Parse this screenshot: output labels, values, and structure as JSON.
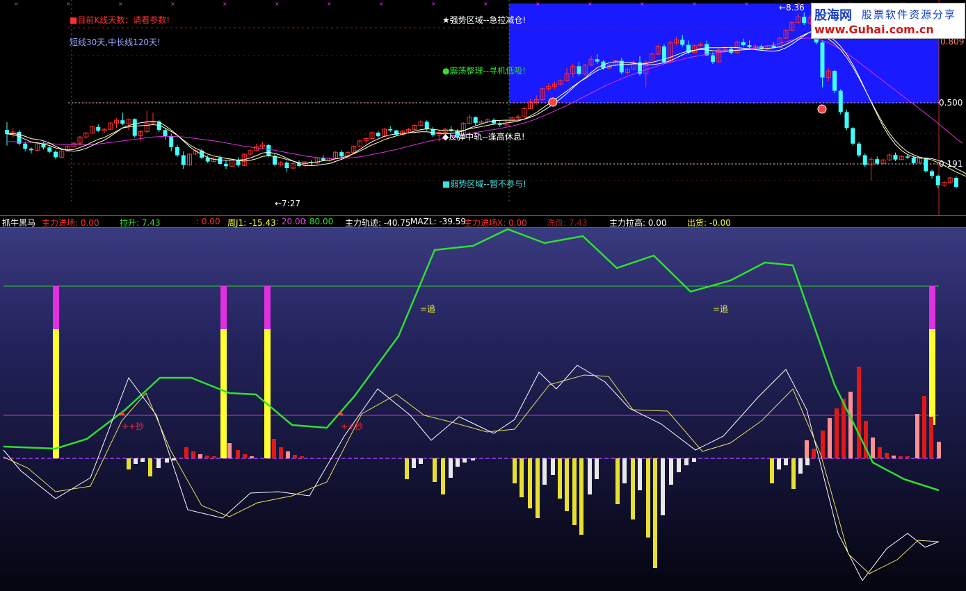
{
  "top_panel": {
    "annotations": [
      {
        "id": "kline",
        "text": "■目前K线天数：请看参数!",
        "color": "#ff3030"
      },
      {
        "id": "mapar",
        "text": "短线30天,中长线120天!",
        "color": "#9aa8ff"
      },
      {
        "id": "strong",
        "text": "★强势区域--急拉减仓!",
        "color": "#ffffff"
      },
      {
        "id": "shock",
        "text": "●震荡整理--寻机低吸!",
        "color": "#30e030"
      },
      {
        "id": "rebound",
        "text": "◆反弹中轨--逢高休息!",
        "color": "#ffffff"
      },
      {
        "id": "weak",
        "text": "■弱势区域--暂不参与!",
        "color": "#40e0e0"
      }
    ],
    "low_label": "←7:27",
    "high_label": "←8.36",
    "y_labels": [
      "0.809",
      "0.500",
      "0.191"
    ]
  },
  "logo": {
    "name": "股海网",
    "slogan": "股票软件资源分享",
    "url": "www.Guhai.com.cn"
  },
  "indicator_bar": [
    {
      "text": "抓牛黑马",
      "color": "#ffffff"
    },
    {
      "text": "主力进场: 0.00",
      "color": "#ff3030"
    },
    {
      "text": "拉升: 7.43",
      "color": "#30e030"
    },
    {
      "text": ": 0.00",
      "color": "#ff3030"
    },
    {
      "text": "周J1: -15.43",
      "color": "#ffff40"
    },
    {
      "text": ": 20.00",
      "color": "#e040e0"
    },
    {
      "text": ": 80.00",
      "color": "#30e030"
    },
    {
      "text": "主力轨迹: -40.75",
      "color": "#ffffff"
    },
    {
      "text": "MAZL: -39.59",
      "color": "#ffffff"
    },
    {
      "text": "主力进场X: 0.00",
      "color": "#ff3030"
    },
    {
      "text": "洗盘: 7.43",
      "color": "#a02020"
    },
    {
      "text": "主力拉高: 0.00",
      "color": "#ffffff"
    },
    {
      "text": "出货: -0.00",
      "color": "#ffff40"
    }
  ],
  "bottom_panel": {
    "chase_labels": [
      "=追",
      "=追"
    ],
    "buy_labels": [
      "++抄",
      "++抄"
    ]
  },
  "chart_data": {
    "type": "candlestick",
    "title": "",
    "candles": [
      [
        18,
        20,
        14,
        17
      ],
      [
        17,
        18.5,
        16,
        17.5
      ],
      [
        17.5,
        18,
        14,
        14.5
      ],
      [
        14.5,
        15,
        12.5,
        13.2
      ],
      [
        13.2,
        13.5,
        12,
        12.8
      ],
      [
        12.8,
        15,
        12.5,
        14.5
      ],
      [
        14.5,
        15,
        13,
        13.5
      ],
      [
        13.5,
        14,
        12,
        12.4
      ],
      [
        12.4,
        12.8,
        10.5,
        11
      ],
      [
        11,
        13,
        10.8,
        12.6
      ],
      [
        12.6,
        14,
        12.4,
        13.8
      ],
      [
        13.8,
        15,
        13.5,
        14.6
      ],
      [
        14.6,
        16.5,
        14.3,
        16.2
      ],
      [
        16.2,
        17.5,
        15.8,
        17.2
      ],
      [
        17.2,
        19,
        17,
        18.8
      ],
      [
        18.8,
        19.5,
        17.5,
        17.8
      ],
      [
        17.8,
        18.5,
        17.2,
        18.2
      ],
      [
        18.2,
        20,
        18,
        19.8
      ],
      [
        19.8,
        21,
        18.5,
        20.5
      ],
      [
        20.5,
        22.5,
        19.2,
        19.6
      ],
      [
        19.6,
        21,
        18,
        20.8
      ],
      [
        20.8,
        21,
        16,
        16.5
      ],
      [
        16.5,
        18,
        15,
        17.6
      ],
      [
        17.6,
        23,
        17.2,
        19.8
      ],
      [
        19.8,
        22.5,
        19.3,
        20.2
      ],
      [
        20.2,
        20.5,
        17.5,
        18
      ],
      [
        18,
        18.5,
        15.5,
        16.4
      ],
      [
        16.4,
        17,
        12.5,
        13.6
      ],
      [
        13.6,
        14.2,
        11,
        11.5
      ],
      [
        11.5,
        12.5,
        8,
        9
      ],
      [
        9,
        12,
        8.8,
        11.8
      ],
      [
        11.8,
        13,
        11.6,
        12.7
      ],
      [
        12.7,
        13.2,
        10.5,
        10.9
      ],
      [
        10.9,
        11.5,
        9.5,
        9.9
      ],
      [
        9.9,
        11,
        9.6,
        10.8
      ],
      [
        10.8,
        11.5,
        9,
        9.3
      ],
      [
        9.3,
        10.2,
        8,
        8.7
      ],
      [
        8.7,
        10.5,
        8.6,
        10.3
      ],
      [
        10.3,
        11,
        8.5,
        8.9
      ],
      [
        8.9,
        12,
        8.7,
        11.8
      ],
      [
        11.8,
        13,
        11.5,
        12.7
      ],
      [
        12.7,
        14.5,
        12.5,
        13.7
      ],
      [
        13.7,
        15,
        13.2,
        14.1
      ],
      [
        14.1,
        14.5,
        11,
        11.3
      ],
      [
        11.3,
        11.8,
        8.8,
        9.1
      ],
      [
        9.1,
        10,
        8.6,
        9.6
      ],
      [
        9.6,
        10,
        7.2,
        8.2
      ],
      [
        8.2,
        9.8,
        8,
        9.4
      ],
      [
        9.4,
        10.2,
        8.5,
        8.8
      ],
      [
        8.8,
        10,
        8.6,
        9.8
      ],
      [
        9.8,
        10.2,
        9,
        9.5
      ],
      [
        9.5,
        11,
        9.3,
        10.8
      ],
      [
        10.8,
        11.5,
        10,
        10.2
      ],
      [
        10.2,
        11,
        9.8,
        10.7
      ],
      [
        10.7,
        12.5,
        10.5,
        12.3
      ],
      [
        12.3,
        12.8,
        10.8,
        11.2
      ],
      [
        11.2,
        12.5,
        10.9,
        12.2
      ],
      [
        12.2,
        14,
        12,
        13.8
      ],
      [
        13.8,
        15.5,
        13.5,
        15.2
      ],
      [
        15.2,
        16,
        14.5,
        15.8
      ],
      [
        15.8,
        17.5,
        15.6,
        17.3
      ],
      [
        17.3,
        17.8,
        16,
        16.4
      ],
      [
        16.4,
        18.5,
        16.2,
        18.2
      ],
      [
        18.2,
        19,
        17.5,
        17.9
      ],
      [
        17.9,
        18,
        16.5,
        16.8
      ],
      [
        16.8,
        18,
        16.6,
        17.7
      ],
      [
        17.7,
        18.5,
        17.3,
        18.1
      ],
      [
        18.1,
        19.5,
        17.9,
        19.2
      ],
      [
        19.2,
        20.5,
        19,
        20.1
      ],
      [
        20.1,
        20.5,
        17.8,
        18.2
      ],
      [
        18.2,
        18.8,
        16.2,
        16.7
      ],
      [
        16.7,
        18,
        15,
        17.4
      ],
      [
        17.4,
        18.5,
        17,
        18.2
      ],
      [
        18.2,
        19,
        17.5,
        17.9
      ],
      [
        17.9,
        18.2,
        15.5,
        16
      ],
      [
        16,
        20,
        15.8,
        19.7
      ],
      [
        19.7,
        22,
        19.4,
        21.3
      ],
      [
        21.3,
        21.5,
        19,
        19.8
      ],
      [
        19.8,
        20.5,
        19.4,
        20.1
      ],
      [
        20.1,
        21,
        19.8,
        20.6
      ],
      [
        20.6,
        21,
        19.3,
        19.7
      ],
      [
        19.7,
        20.2,
        18.8,
        19.3
      ],
      [
        19.3,
        20.5,
        18.9,
        20.1
      ],
      [
        20.1,
        21.5,
        19.9,
        21.1
      ],
      [
        21.1,
        22,
        20.6,
        21.4
      ],
      [
        21.4,
        24,
        21.2,
        23.5
      ],
      [
        23.5,
        26,
        23.3,
        25.2
      ],
      [
        25.2,
        27,
        24.5,
        25.8
      ],
      [
        25.8,
        29,
        25.5,
        28.6
      ],
      [
        28.6,
        30,
        28,
        29.2
      ],
      [
        29.2,
        30.5,
        28.5,
        29.8
      ],
      [
        29.8,
        31,
        29.4,
        30.7
      ],
      [
        30.7,
        34,
        30.5,
        32.5
      ],
      [
        32.5,
        35,
        31.5,
        34.4
      ],
      [
        34.4,
        35.5,
        32,
        32.4
      ],
      [
        32.4,
        35,
        32,
        34.7
      ],
      [
        34.7,
        37,
        34.4,
        36.2
      ],
      [
        36.2,
        37.5,
        35,
        35.6
      ],
      [
        35.6,
        36,
        33.5,
        33.9
      ],
      [
        33.9,
        35,
        33.7,
        34.6
      ],
      [
        34.6,
        36,
        34.4,
        35.8
      ],
      [
        35.8,
        36.5,
        32.3,
        32.8
      ],
      [
        32.8,
        34,
        32.2,
        33.6
      ],
      [
        33.6,
        36,
        33.4,
        35.4
      ],
      [
        35.4,
        37,
        32,
        32.5
      ],
      [
        32.5,
        36,
        29,
        35.4
      ],
      [
        35.4,
        38,
        35.2,
        37.5
      ],
      [
        37.5,
        40,
        37.3,
        39.5
      ],
      [
        39.5,
        40,
        35,
        35.5
      ],
      [
        35.5,
        41,
        35.2,
        40.4
      ],
      [
        40.4,
        42,
        39.8,
        41.2
      ],
      [
        41.2,
        42.5,
        39.5,
        39.9
      ],
      [
        39.9,
        41,
        37.5,
        37.9
      ],
      [
        37.9,
        40,
        37.8,
        39.7
      ],
      [
        39.7,
        40.5,
        39.4,
        40.1
      ],
      [
        40.1,
        41,
        37,
        37.2
      ],
      [
        37.2,
        38,
        35,
        35.5
      ],
      [
        35.5,
        39,
        35.3,
        38.6
      ],
      [
        38.6,
        39.5,
        38,
        38.9
      ],
      [
        38.9,
        39.4,
        37.5,
        37.9
      ],
      [
        37.9,
        41,
        37.7,
        40.6
      ],
      [
        40.6,
        41.5,
        39.5,
        39.8
      ],
      [
        39.8,
        41,
        39,
        39.3
      ],
      [
        39.3,
        40,
        38.5,
        39.6
      ],
      [
        39.6,
        40,
        38.4,
        38.8
      ],
      [
        38.8,
        40,
        38.6,
        39.7
      ],
      [
        39.7,
        40.5,
        39,
        39.2
      ],
      [
        39.2,
        42,
        39,
        41.6
      ],
      [
        41.6,
        44,
        41.4,
        43.6
      ],
      [
        43.6,
        46,
        43.4,
        45.6
      ],
      [
        45.6,
        48,
        45.4,
        47.1
      ],
      [
        47.1,
        48.2,
        45,
        45.5
      ],
      [
        45.5,
        47.5,
        45,
        46.9
      ],
      [
        46.9,
        47.2,
        40,
        40.5
      ],
      [
        40.5,
        41,
        29,
        31.5
      ],
      [
        31.5,
        34,
        30.5,
        33.2
      ],
      [
        33.2,
        33.5,
        27.5,
        28.1
      ],
      [
        28.1,
        28.5,
        22,
        22.6
      ],
      [
        22.6,
        23.2,
        18,
        18.5
      ],
      [
        18.5,
        18.8,
        14,
        14.5
      ],
      [
        14.5,
        15,
        11,
        11.5
      ],
      [
        11.5,
        12,
        8.5,
        9
      ],
      [
        9,
        11,
        5,
        10.5
      ],
      [
        10.5,
        11.2,
        9,
        9.4
      ],
      [
        9.4,
        10.6,
        9.1,
        10.3
      ],
      [
        10.3,
        12,
        10,
        11.6
      ],
      [
        11.6,
        12.2,
        10,
        10.4
      ],
      [
        10.4,
        11.5,
        10.2,
        11.2
      ],
      [
        11.2,
        11.8,
        10.5,
        10.9
      ],
      [
        10.9,
        11.2,
        9,
        9.5
      ],
      [
        9.5,
        11,
        9.3,
        10.8
      ],
      [
        10.8,
        11,
        7,
        7.4
      ],
      [
        7.4,
        7.8,
        5.5,
        6.2
      ],
      [
        6.2,
        6.5,
        3,
        3.8
      ],
      [
        3.8,
        5,
        3.4,
        4.5
      ],
      [
        4.5,
        6,
        4.2,
        5.7
      ],
      [
        5.7,
        6,
        3,
        3.4
      ]
    ],
    "ma_short": [
      17,
      16.8,
      16.3,
      15.6,
      14.9,
      14.7,
      14.4,
      14,
      13.4,
      13,
      12.9,
      13,
      13.5,
      14.1,
      14.9,
      15.6,
      16.1,
      16.9,
      17.7,
      18.5,
      18.8,
      19,
      19.1,
      19.2,
      19.4,
      19.2,
      18.5,
      17.6,
      16.6,
      15.4,
      14.2,
      13.3,
      12.6,
      11.8,
      11.3,
      11,
      10.7,
      10.5,
      10.2,
      10,
      10.2,
      10.6,
      11.2,
      11.4,
      11.2,
      10.9,
      10.4,
      10,
      9.6,
      9.4,
      9.6,
      9.8,
      10.1,
      10.2,
      10.6,
      10.9,
      11.3,
      11.9,
      12.6,
      13.4,
      14.2,
      14.8,
      15.5,
      16,
      16.5,
      16.9,
      17.3,
      17.7,
      18.1,
      18.3,
      18.2,
      18,
      17.8,
      17.8,
      17.7,
      17.9,
      18.3,
      18.6,
      18.9,
      19.2,
      19.5,
      19.6,
      19.8,
      20,
      20.3,
      20.8,
      21.6,
      22.5,
      23.6,
      24.7,
      25.8,
      26.9,
      28,
      29.2,
      30.3,
      31.2,
      32.3,
      33.3,
      33.9,
      34.4,
      34.7,
      34.8,
      34.9,
      35,
      35,
      35.1,
      35.4,
      35.8,
      36.2,
      36.7,
      37.3,
      37.9,
      38.3,
      38.5,
      38.7,
      38.6,
      38.4,
      38.3,
      38.3,
      38.4,
      38.5,
      38.6,
      38.7,
      38.8,
      38.9,
      39,
      39.1,
      39.4,
      40,
      40.8,
      41.7,
      42.5,
      43.2,
      43.2,
      42.4,
      41.4,
      40.2,
      38.6,
      36.6,
      34.2,
      31.4,
      28.4,
      25.4,
      22.4,
      19.6,
      17.2,
      15.2,
      13.6,
      12.4,
      11.6,
      11,
      10.7,
      10.3,
      9.6,
      8.9,
      8,
      7.2,
      6.5,
      5.8
    ],
    "ma_long": [
      15,
      15,
      14.9,
      14.9,
      14.8,
      14.7,
      14.6,
      14.5,
      14.4,
      14.3,
      14.2,
      14.2,
      14.2,
      14.2,
      14.3,
      14.4,
      14.6,
      14.8,
      15,
      15.2,
      15.4,
      15.6,
      15.8,
      16,
      16.2,
      16.3,
      16.4,
      16.4,
      16.3,
      16.2,
      16,
      15.8,
      15.6,
      15.4,
      15.2,
      15,
      14.7,
      14.4,
      14.1,
      13.8,
      13.6,
      13.4,
      13.2,
      13,
      12.8,
      12.5,
      12.2,
      11.9,
      11.6,
      11.3,
      11.1,
      10.9,
      10.8,
      10.7,
      10.7,
      10.7,
      10.8,
      10.9,
      11.1,
      11.4,
      11.7,
      12,
      12.3,
      12.7,
      13,
      13.4,
      13.8,
      14.2,
      14.6,
      15,
      15.3,
      15.6,
      15.9,
      16.2,
      16.5,
      16.8,
      17.1,
      17.4,
      17.6,
      17.9,
      18.1,
      18.4,
      18.7,
      19,
      19.4,
      19.8,
      20.3,
      20.9,
      21.5,
      22.2,
      22.9,
      23.6,
      24.3,
      25.1,
      25.9,
      26.7,
      27.5,
      28.3,
      29.1,
      29.8,
      30.5,
      31.2,
      31.8,
      32.4,
      33,
      33.5,
      34,
      34.5,
      35,
      35.4,
      35.8,
      36.2,
      36.6,
      36.9,
      37.2,
      37.5,
      37.7,
      37.9,
      38.1,
      38.3,
      38.5,
      38.7,
      38.9,
      39.1,
      39.3,
      39.6,
      39.9,
      40.3,
      40.7,
      41.1,
      41.4,
      41.6,
      41.6,
      41.4,
      41,
      40.4,
      39.6,
      38.7,
      37.7,
      36.6,
      35.4,
      34.2,
      33,
      31.8,
      30.6,
      29.4,
      28.2,
      27,
      25.8,
      24.6,
      23.4,
      22.2,
      21,
      19.7,
      18.4,
      17.1,
      15.8,
      14.6
    ],
    "ylim": [
      0,
      50
    ]
  }
}
